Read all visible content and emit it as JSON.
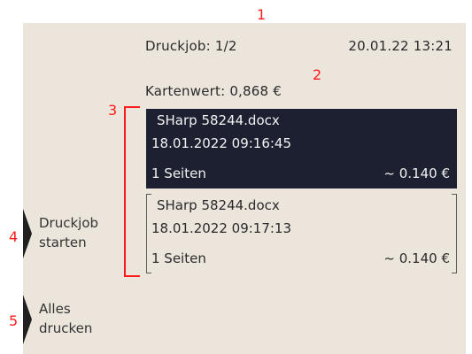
{
  "header": {
    "job_counter": "Druckjob: 1/2",
    "timestamp": "20.01.22 13:21",
    "card_value": "Kartenwert: 0,868 €"
  },
  "jobs": [
    {
      "filename": "SHarp 58244.docx",
      "datetime": "18.01.2022 09:16:45",
      "pages": "1 Seiten",
      "price": "~ 0.140 €",
      "selected": true
    },
    {
      "filename": "SHarp 58244.docx",
      "datetime": "18.01.2022 09:17:13",
      "pages": "1 Seiten",
      "price": "~ 0.140 €",
      "selected": false
    }
  ],
  "softkeys": [
    {
      "label": "Druckjob starten"
    },
    {
      "label": "Alles drucken"
    }
  ],
  "annotations": [
    "1",
    "2",
    "3",
    "4",
    "5"
  ],
  "colors": {
    "background": "#ebe5dc",
    "selected_bg": "#1d2030",
    "selected_text": "#f2f2f2",
    "annotation": "#ff1b1b"
  }
}
